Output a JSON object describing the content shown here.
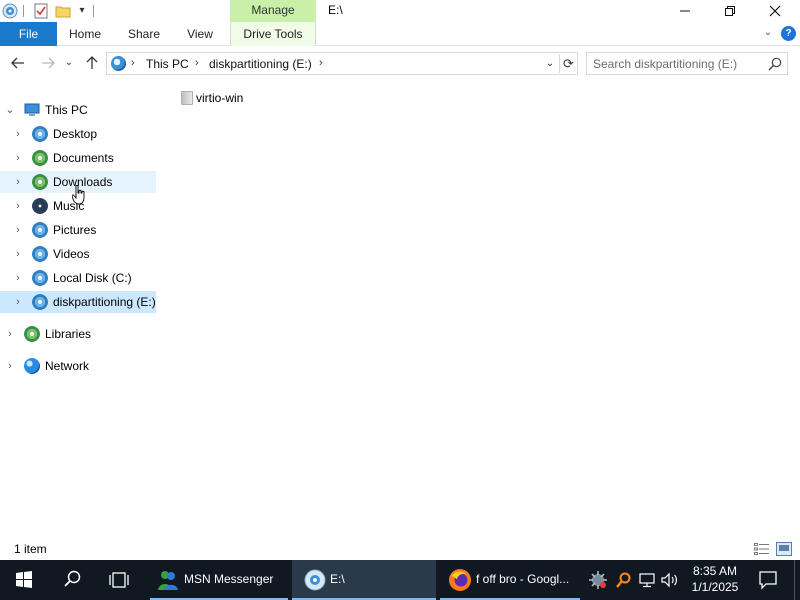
{
  "window": {
    "title": "E:\\",
    "context_tab": "Manage"
  },
  "ribbon": {
    "file": "File",
    "tabs": [
      "Home",
      "Share",
      "View"
    ],
    "drive_tools": "Drive Tools"
  },
  "address": {
    "crumbs": [
      "This PC",
      "diskpartitioning (E:)"
    ]
  },
  "search": {
    "placeholder": "Search diskpartitioning (E:)"
  },
  "nav": {
    "root": "This PC",
    "items": [
      "Desktop",
      "Documents",
      "Downloads",
      "Music",
      "Pictures",
      "Videos",
      "Local Disk (C:)",
      "diskpartitioning (E:)"
    ],
    "libraries": "Libraries",
    "network": "Network"
  },
  "files": [
    {
      "name": "virtio-win"
    }
  ],
  "status": {
    "count": "1 item"
  },
  "taskbar": {
    "apps": [
      "MSN Messenger",
      "E:\\",
      "f off bro - Googl..."
    ],
    "time": "8:35 AM",
    "date": "1/1/2025"
  },
  "colors": {
    "file_tab": "#1979ca",
    "manage_tab": "#c8f0a8",
    "selected": "#cce8ff",
    "hover": "#e5f3ff",
    "taskbar": "#101822"
  }
}
